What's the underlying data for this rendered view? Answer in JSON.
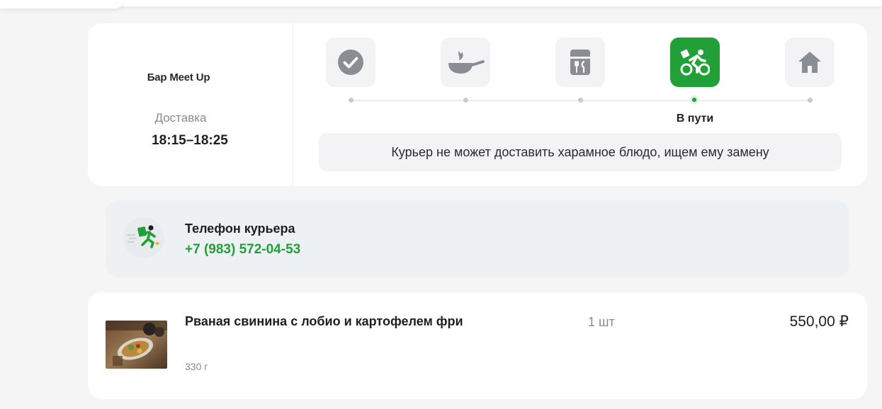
{
  "order": {
    "restaurant": "Бар Meet Up",
    "delivery_label": "Доставка",
    "delivery_time": "18:15–18:25"
  },
  "progress": {
    "steps": [
      {
        "icon": "check-circle-icon",
        "state": "done"
      },
      {
        "icon": "frying-pan-icon",
        "state": "done"
      },
      {
        "icon": "packed-bag-icon",
        "state": "done"
      },
      {
        "icon": "cyclist-courier-icon",
        "state": "active",
        "caption": "В пути"
      },
      {
        "icon": "home-icon",
        "state": "pending"
      }
    ],
    "notice": "Курьер не может доставить харамное блюдо, ищем ему замену"
  },
  "courier": {
    "icon": "running-courier-icon",
    "title": "Телефон курьера",
    "phone": "+7 (983) 572-04-53"
  },
  "items": [
    {
      "name": "Рваная свинина с лобио и картофелем фри",
      "weight": "330 г",
      "quantity": "1 шт",
      "price": "550,00 ₽"
    }
  ],
  "colors": {
    "accent": "#21a038",
    "tile": "#f3f3f5",
    "icon_gray": "#8a8d93"
  }
}
